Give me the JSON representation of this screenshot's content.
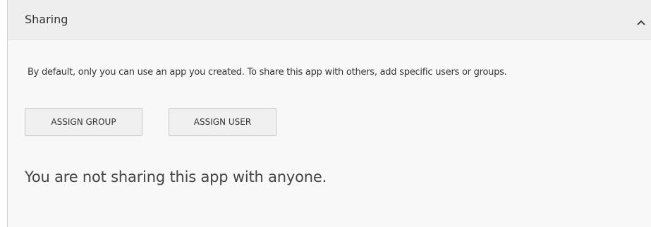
{
  "sharing": {
    "title": "Sharing",
    "toggle_icon": "chevron-up-icon",
    "description": "By default, only you can use an app you created. To share this app with others, add specific users or groups.",
    "buttons": {
      "assign_group": "ASSIGN GROUP",
      "assign_user": "ASSIGN USER"
    },
    "empty_message": "You are not sharing this app with anyone."
  },
  "colors": {
    "header_bg": "#eeeeee",
    "panel_bg": "#f8f8f8",
    "button_bg": "#f0f0f0",
    "text": "#333333"
  }
}
